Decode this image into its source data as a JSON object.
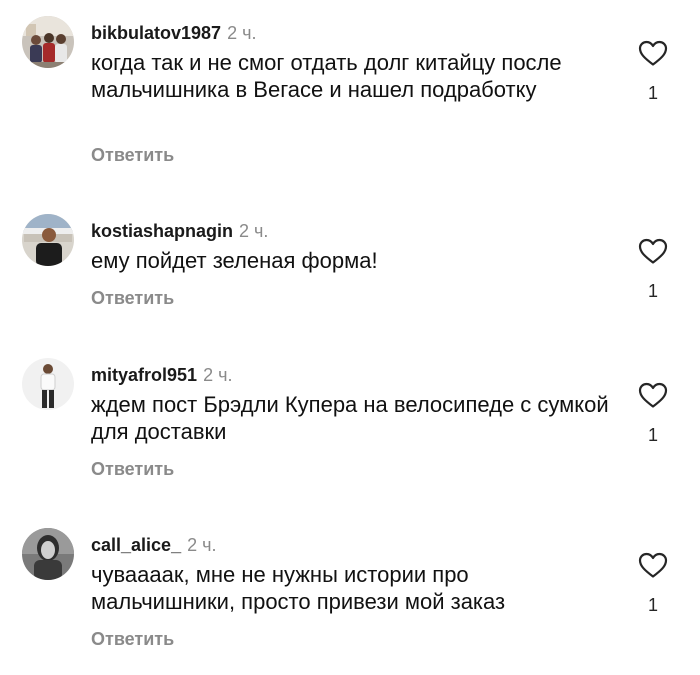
{
  "comments": [
    {
      "username": "bikbulatov1987",
      "time": "2 ч.",
      "text": "когда так и не смог отдать долг китайцу после мальчишника в Вегасе и нашел подработку",
      "reply_label": "Ответить",
      "likes": "1",
      "avatar_icon": "avatar-photo-group",
      "like_icon": "heart-outline-icon"
    },
    {
      "username": "kostiashapnagin",
      "time": "2 ч.",
      "text": "ему пойдет зеленая форма!",
      "reply_label": "Ответить",
      "likes": "1",
      "avatar_icon": "avatar-photo-man-black-shirt",
      "like_icon": "heart-outline-icon"
    },
    {
      "username": "mityafrol951",
      "time": "2 ч.",
      "text": "ждем пост Брэдли Купера на велосипеде с сумкой для доставки",
      "reply_label": "Ответить",
      "likes": "1",
      "avatar_icon": "avatar-photo-man-standing",
      "like_icon": "heart-outline-icon"
    },
    {
      "username": "call_alice_",
      "time": "2 ч.",
      "text": "чуваааак, мне не нужны истории про мальчишники, просто привези мой заказ",
      "reply_label": "Ответить",
      "likes": "1",
      "avatar_icon": "avatar-photo-bw-portrait",
      "like_icon": "heart-outline-icon"
    }
  ],
  "colors": {
    "text": "#111111",
    "muted": "#8a8a8a",
    "background": "#ffffff"
  }
}
